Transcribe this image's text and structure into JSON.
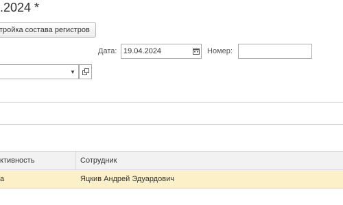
{
  "window": {
    "title": ".2024 *"
  },
  "toolbar": {
    "register_settings_label": "тройка состава регистров"
  },
  "form": {
    "date_label": "Дата:",
    "date_value": "19.04.2024",
    "number_label": "Номер:",
    "number_value": "",
    "select_value": ""
  },
  "table": {
    "columns": [
      "ктивность",
      "Сотрудник"
    ],
    "rows": [
      {
        "activity": "а",
        "employee": "Яцкив Андрей Эдуардович"
      }
    ]
  },
  "colors": {
    "selected_row": "#fbf0c8",
    "header_bg": "#f2f2f2"
  }
}
